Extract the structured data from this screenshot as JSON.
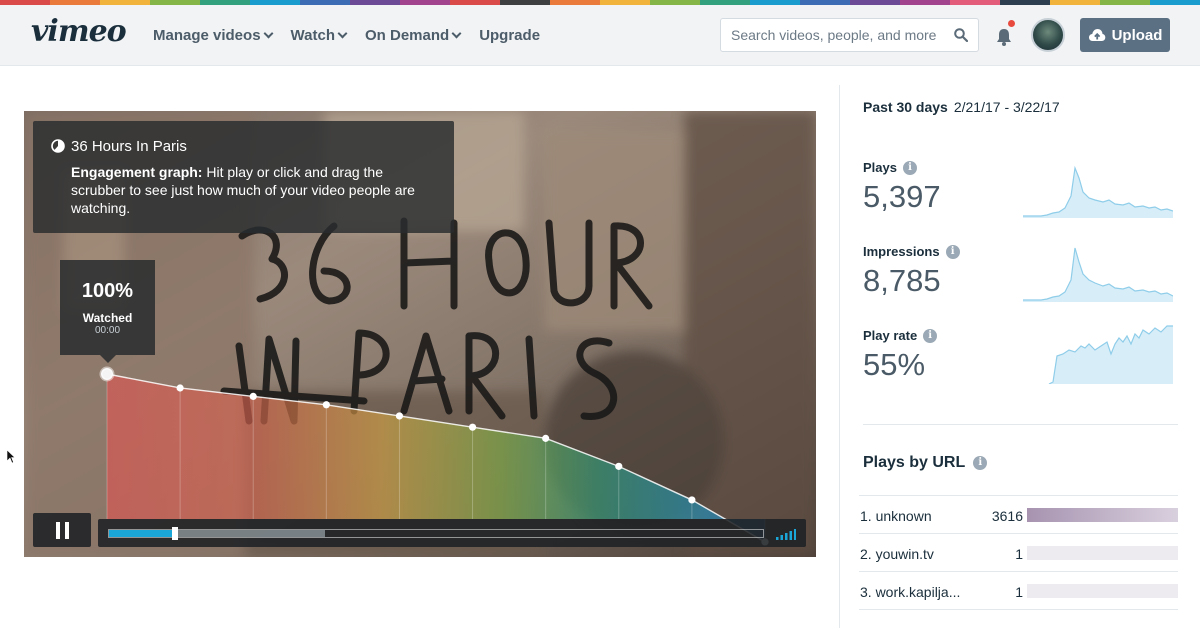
{
  "colors": {
    "accent": "#1aa7d8",
    "upload_button": "#5b7083",
    "rainbow": [
      "#d94a49",
      "#e97a3b",
      "#f2b33d",
      "#84b546",
      "#32a07c",
      "#1a9ccf",
      "#3c6cb4",
      "#6c4a96",
      "#a1448d",
      "#d94a49",
      "#3d3f41",
      "#e97a3b",
      "#f2b33d",
      "#84b546",
      "#32a07c",
      "#1a9ccf",
      "#3c6cb4",
      "#6c4a96",
      "#a1448d",
      "#e35d7b",
      "#2c3e50",
      "#f2b33d",
      "#84b546",
      "#1a9ccf"
    ]
  },
  "header": {
    "logo": "vimeo",
    "nav": [
      "Manage videos",
      "Watch",
      "On Demand",
      "Upgrade"
    ],
    "search_placeholder": "Search videos, people, and more",
    "upload_label": "Upload"
  },
  "player": {
    "video_title": "36 Hours In Paris",
    "tip_heading": "Engagement graph:",
    "tip_text": "Hit play or click and drag the scrubber to see just how much of your video people are watching.",
    "watched_percent": "100%",
    "watched_label": "Watched",
    "watched_time": "00:00",
    "engagement_percent": [
      100,
      95,
      92,
      89,
      85,
      81,
      77,
      67,
      55,
      40
    ],
    "progress": 0.1,
    "buffered": 0.33
  },
  "stats": {
    "range_label": "Past 30 days",
    "range_dates": "2/21/17 - 3/22/17",
    "plays_label": "Plays",
    "plays_value": "5,397",
    "impressions_label": "Impressions",
    "impressions_value": "8,785",
    "play_rate_label": "Play rate",
    "play_rate_value": "55%"
  },
  "plays_by_url": {
    "title": "Plays by URL",
    "rows": [
      {
        "name": "1. unknown",
        "count": "3616",
        "share": 1.0
      },
      {
        "name": "2. youwin.tv",
        "count": "1",
        "share": 0.0
      },
      {
        "name": "3. work.kapilja...",
        "count": "1",
        "share": 0.0
      }
    ]
  }
}
